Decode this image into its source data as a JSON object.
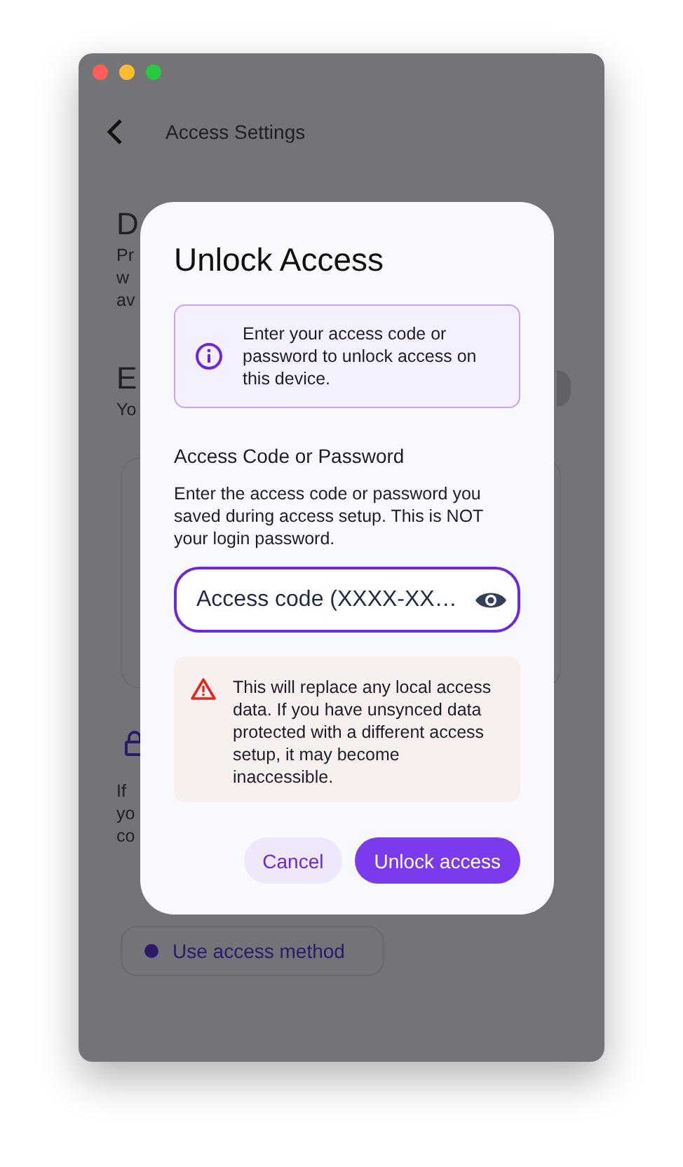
{
  "header": {
    "title": "Access Settings"
  },
  "background": {
    "sections": [
      {
        "heading": "D",
        "lines": [
          "Pr",
          "w",
          "av"
        ]
      },
      {
        "heading": "E",
        "lines": [
          "Yo"
        ]
      },
      {
        "lines": [
          "If",
          "yo",
          "co"
        ],
        "button": "Use access method"
      }
    ]
  },
  "dialog": {
    "title": "Unlock Access",
    "info": "Enter your access code or password to unlock access on this device.",
    "field": {
      "label": "Access Code or Password",
      "help": "Enter the access code or password you saved during access setup. This is NOT your login password.",
      "placeholder": "Access code (XXXX-XX…"
    },
    "warning": "This will replace any local access data. If you have unsynced data protected with a different access setup, it may become inaccessible.",
    "buttons": [
      {
        "label": "Cancel",
        "kind": "secondary"
      },
      {
        "label": "Unlock access",
        "kind": "primary"
      }
    ]
  }
}
